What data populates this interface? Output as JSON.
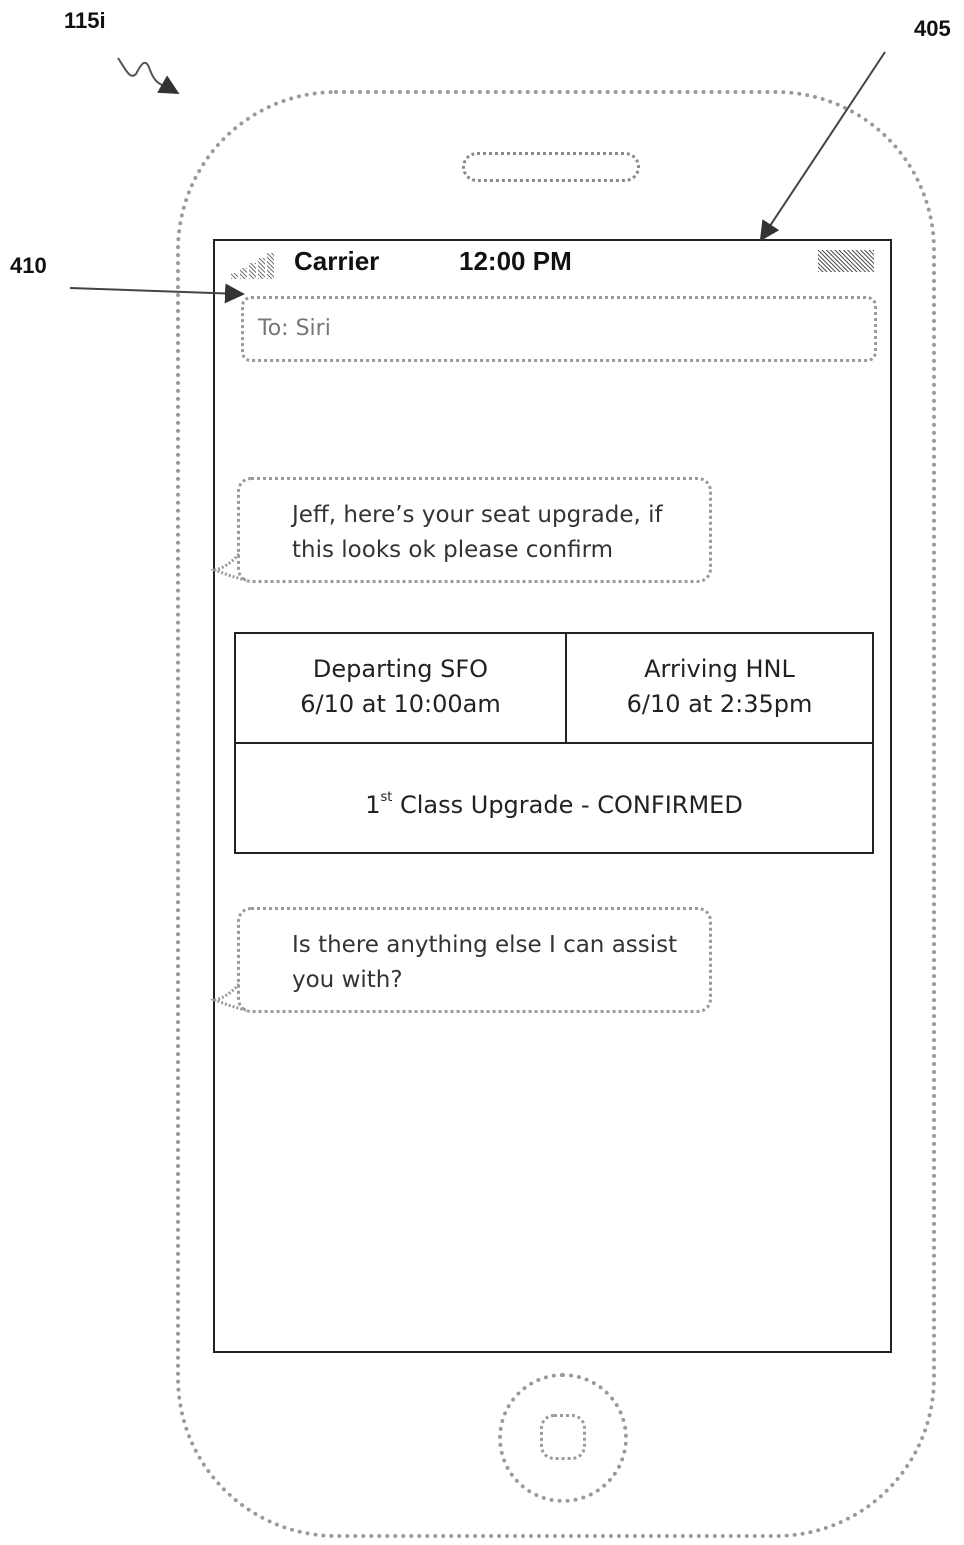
{
  "figure": {
    "reference_labels": {
      "device": "115i",
      "screen": "405",
      "to_field": "410"
    }
  },
  "status_bar": {
    "signal_icon": "signal-strength-icon",
    "carrier": "Carrier",
    "time": "12:00 PM",
    "battery_icon": "battery-icon"
  },
  "recipient": {
    "text": "To: Siri"
  },
  "messages": [
    {
      "text": "Jeff, here’s your seat upgrade, if this looks ok please confirm"
    },
    {
      "text": "Is there anything else I can assist you with?"
    }
  ],
  "flight_card": {
    "departing": {
      "line1": "Departing SFO",
      "line2": "6/10 at 10:00am"
    },
    "arriving": {
      "line1": "Arriving HNL",
      "line2": "6/10 at 2:35pm"
    },
    "upgrade": {
      "ordinal_number": "1",
      "ordinal_suffix": "st",
      "rest": " Class Upgrade - CONFIRMED"
    }
  },
  "hardware": {
    "speaker": "speaker-grille",
    "home_button": "home-button"
  }
}
